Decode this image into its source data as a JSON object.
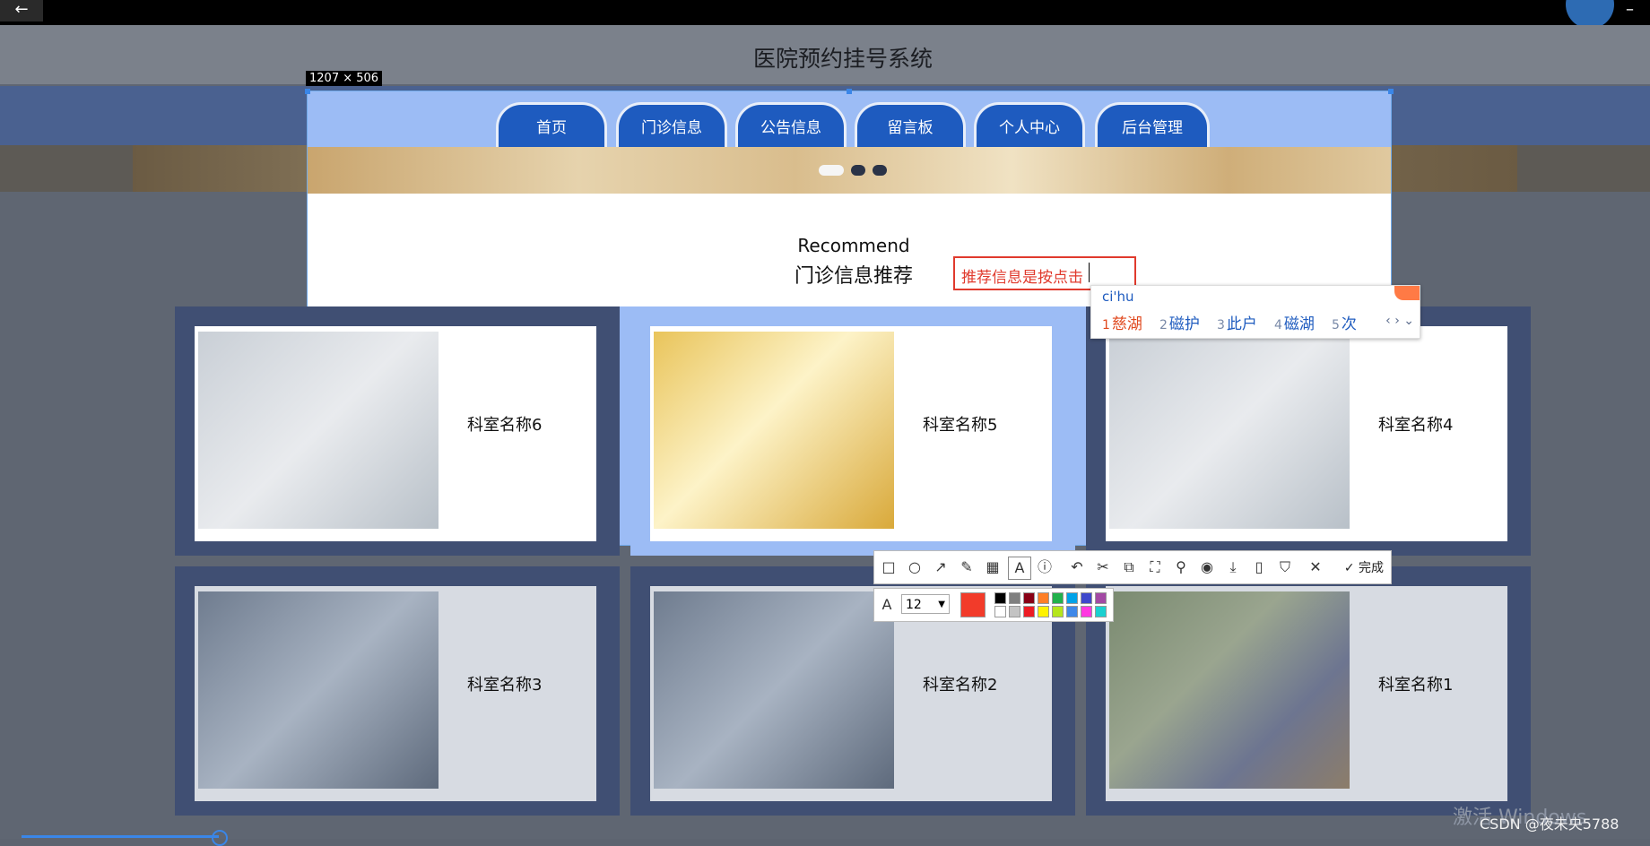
{
  "window": {
    "back_glyph": "←",
    "minimize_glyph": "–"
  },
  "site": {
    "title": "医院预约挂号系统",
    "nav": [
      "首页",
      "门诊信息",
      "公告信息",
      "留言板",
      "个人中心",
      "后台管理"
    ]
  },
  "selection": {
    "size_label": "1207 × 506"
  },
  "recommend": {
    "title": "Recommend",
    "subtitle": "门诊信息推荐"
  },
  "text_annotation": {
    "value": "推荐信息是按点击"
  },
  "ime": {
    "pinyin": "ci'hu",
    "candidates": [
      {
        "num": "1",
        "text": "慈湖"
      },
      {
        "num": "2",
        "text": "磁护"
      },
      {
        "num": "3",
        "text": "此户"
      },
      {
        "num": "4",
        "text": "磁湖"
      },
      {
        "num": "5",
        "text": "次"
      }
    ],
    "nav_arrows": "‹ › ⌄"
  },
  "departments": [
    {
      "name": "科室名称6"
    },
    {
      "name": "科室名称5"
    },
    {
      "name": "科室名称4"
    },
    {
      "name": "科室名称3"
    },
    {
      "name": "科室名称2"
    },
    {
      "name": "科室名称1"
    }
  ],
  "toolbar": {
    "finish_label": "完成",
    "font_size": "12",
    "current_color": "#f23b2a",
    "palette": [
      "#000000",
      "#7f7f7f",
      "#880015",
      "#ff7f27",
      "#22b14c",
      "#00a2e8",
      "#3f48cc",
      "#a349a4",
      "#ffffff",
      "#c3c3c3",
      "#ed1c24",
      "#fff200",
      "#b5e61d",
      "#3f88e8",
      "#ff39e1",
      "#1bd0d0"
    ]
  },
  "footer": {
    "activate": "激活 Windows",
    "credit": "CSDN @夜未央5788"
  }
}
